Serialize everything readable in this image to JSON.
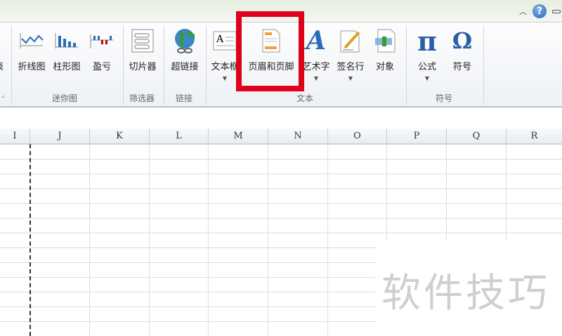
{
  "window": {
    "help_icon": "?"
  },
  "ribbon": {
    "partial_label": "表",
    "buttons": [
      {
        "id": "line",
        "label": "折线图"
      },
      {
        "id": "column",
        "label": "柱形图"
      },
      {
        "id": "winloss",
        "label": "盈亏"
      },
      {
        "id": "slicer",
        "label": "切片器"
      },
      {
        "id": "hyperlink",
        "label": "超链接"
      },
      {
        "id": "textbox",
        "label": "文本框"
      },
      {
        "id": "headerfooter",
        "label": "页眉和页脚"
      },
      {
        "id": "wordart",
        "label": "艺术字"
      },
      {
        "id": "signature",
        "label": "签名行"
      },
      {
        "id": "object",
        "label": "对象"
      },
      {
        "id": "equation",
        "label": "公式"
      },
      {
        "id": "symbol",
        "label": "符号"
      }
    ],
    "groups": {
      "sparklines": "迷你图",
      "filter": "筛选器",
      "links": "链接",
      "text": "文本",
      "symbols": "符号"
    },
    "highlight_color": "#e0001b"
  },
  "columns": [
    "I",
    "J",
    "K",
    "L",
    "M",
    "N",
    "O",
    "P",
    "Q",
    "R"
  ],
  "watermark": "软件技巧"
}
